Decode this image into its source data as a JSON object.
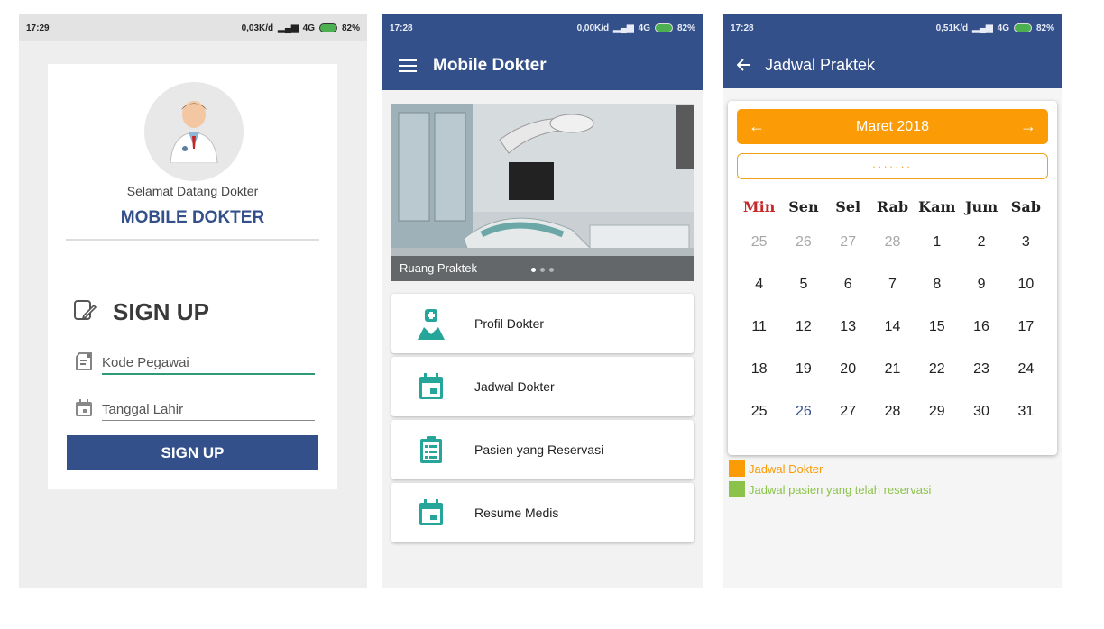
{
  "colors": {
    "primary": "#33508a",
    "accent_orange": "#fb9b05",
    "accent_green": "#8bc34a",
    "teal_icon": "#26a69a",
    "sunday_red": "#c62828"
  },
  "screens": {
    "login": {
      "status": {
        "time": "17:29",
        "net": "0,03K/d",
        "network": "4G",
        "battery": "82%"
      },
      "welcome": "Selamat Datang Dokter",
      "app_name": "MOBILE DOKTER",
      "signup_heading": "SIGN UP",
      "kode_placeholder": "Kode Pegawai",
      "tanggal_placeholder": "Tanggal Lahir",
      "signup_button": "SIGN UP",
      "icons": {
        "heading": "edit-icon",
        "kode": "id-card-icon",
        "tanggal": "calendar-icon",
        "avatar": "doctor-avatar"
      }
    },
    "dashboard": {
      "status": {
        "time": "17:28",
        "net": "0,00K/d",
        "network": "4G",
        "battery": "82%"
      },
      "title": "Mobile Dokter",
      "banner_caption": "Ruang Praktek",
      "menu": [
        {
          "label": "Profil Dokter",
          "icon": "doctor-icon"
        },
        {
          "label": "Jadwal Dokter",
          "icon": "calendar-icon"
        },
        {
          "label": "Pasien yang Reservasi",
          "icon": "clipboard-list-icon"
        },
        {
          "label": "Resume Medis",
          "icon": "calendar-icon"
        }
      ]
    },
    "schedule": {
      "status": {
        "time": "17:28",
        "net": "0,51K/d",
        "network": "4G",
        "battery": "82%"
      },
      "title": "Jadwal Praktek",
      "month": "Maret 2018",
      "dots_text": ".......",
      "weekdays": [
        "Min",
        "Sen",
        "Sel",
        "Rab",
        "Kam",
        "Jum",
        "Sab"
      ],
      "days": [
        {
          "d": "25",
          "other": true
        },
        {
          "d": "26",
          "other": true
        },
        {
          "d": "27",
          "other": true
        },
        {
          "d": "28",
          "other": true
        },
        {
          "d": "1"
        },
        {
          "d": "2"
        },
        {
          "d": "3"
        },
        {
          "d": "4"
        },
        {
          "d": "5"
        },
        {
          "d": "6"
        },
        {
          "d": "7"
        },
        {
          "d": "8"
        },
        {
          "d": "9"
        },
        {
          "d": "10"
        },
        {
          "d": "11"
        },
        {
          "d": "12"
        },
        {
          "d": "13"
        },
        {
          "d": "14"
        },
        {
          "d": "15"
        },
        {
          "d": "16"
        },
        {
          "d": "17"
        },
        {
          "d": "18"
        },
        {
          "d": "19"
        },
        {
          "d": "20"
        },
        {
          "d": "21"
        },
        {
          "d": "22"
        },
        {
          "d": "23"
        },
        {
          "d": "24"
        },
        {
          "d": "25"
        },
        {
          "d": "26",
          "today": true
        },
        {
          "d": "27"
        },
        {
          "d": "28"
        },
        {
          "d": "29"
        },
        {
          "d": "30"
        },
        {
          "d": "31"
        }
      ],
      "legend": [
        {
          "label": "Jadwal Dokter",
          "color": "#fb9b05"
        },
        {
          "label": "Jadwal pasien yang telah reservasi",
          "color": "#8bc34a"
        }
      ]
    }
  }
}
